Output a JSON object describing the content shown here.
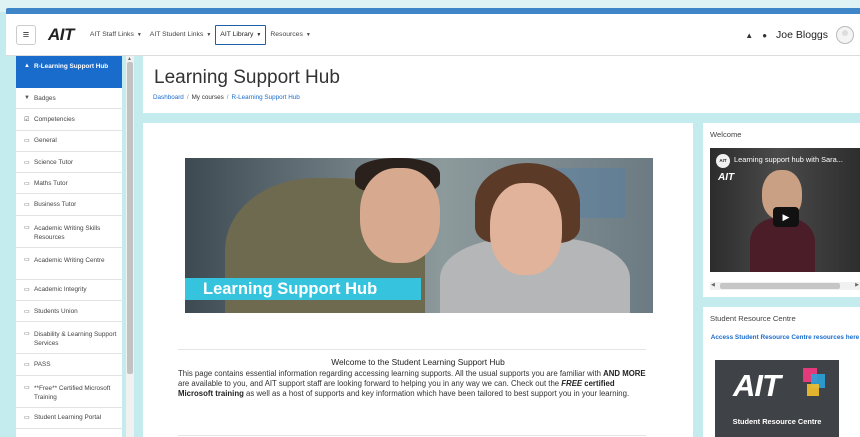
{
  "navbar": {
    "logo": "AIT",
    "menu": [
      {
        "label": "AIT Staff Links",
        "active": false
      },
      {
        "label": "AIT Student Links",
        "active": false
      },
      {
        "label": "AIT Library",
        "active": true
      },
      {
        "label": "Resources",
        "active": false
      }
    ],
    "user_name": "Joe Bloggs",
    "icons": [
      "menu-icon",
      "bell-icon",
      "chat-icon",
      "avatar-icon"
    ]
  },
  "sidebar": {
    "items": [
      {
        "label": "R-Learning Support Hub",
        "icon": "graduation-cap-icon",
        "active": true
      },
      {
        "label": "Badges",
        "icon": "shield-icon"
      },
      {
        "label": "Competencies",
        "icon": "checkbox-icon"
      },
      {
        "label": "General",
        "icon": "folder-icon"
      },
      {
        "label": "Science Tutor",
        "icon": "folder-icon"
      },
      {
        "label": "Maths Tutor",
        "icon": "folder-icon"
      },
      {
        "label": "Business Tutor",
        "icon": "folder-icon"
      },
      {
        "label": "Academic Writing Skills Resources",
        "icon": "folder-icon"
      },
      {
        "label": "Academic Writing Centre",
        "icon": "folder-icon"
      },
      {
        "label": "Academic Integrity",
        "icon": "folder-icon"
      },
      {
        "label": "Students Union",
        "icon": "folder-icon"
      },
      {
        "label": "Disability & Learning Support Services",
        "icon": "folder-icon"
      },
      {
        "label": "PASS",
        "icon": "folder-icon"
      },
      {
        "label": "**Free** Certified Microsoft Training",
        "icon": "folder-icon"
      },
      {
        "label": "Student Learning Portal",
        "icon": "folder-icon"
      }
    ]
  },
  "header": {
    "title": "Learning Support Hub",
    "breadcrumb": [
      "Dashboard",
      "My courses",
      "R-Learning Support Hub"
    ]
  },
  "main": {
    "banner_text": "Learning Support Hub",
    "welcome_title": "Welcome to the Student Learning Support Hub",
    "welcome_p1": "This page contains essential information regarding accessing learning supports.  All the usual supports you are familiar with ",
    "welcome_b1": "AND MORE",
    "welcome_p2": " are available to you, and AIT support staff are looking forward to helping you in any way we can.  Check out the ",
    "welcome_i1": "FREE",
    "welcome_b2": " certified Microsoft training",
    "welcome_p3": " as well as a host of supports and key information which have been tailored to best support you in your learning."
  },
  "blocks": {
    "welcome": {
      "title": "Welcome",
      "video_title": "Learning support hub with Sara...",
      "video_logo": "AIT"
    },
    "src": {
      "title": "Student Resource Centre",
      "link": "Access Student Resource Centre resources here",
      "logo_text": "AIT",
      "logo_caption": "Student Resource Centre"
    }
  },
  "colors": {
    "accent": "#1a6ccc",
    "page_bg": "#c4ecef",
    "banner_label": "#36c3de"
  }
}
